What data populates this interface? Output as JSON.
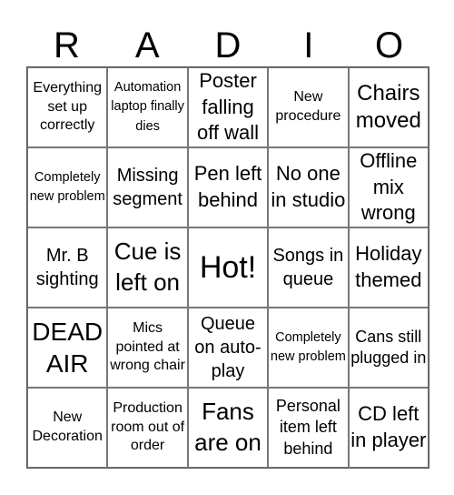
{
  "title_letters": [
    "R",
    "A",
    "D",
    "I",
    "O"
  ],
  "cells": [
    {
      "text": "Everything set up correctly"
    },
    {
      "text": "Automation laptop finally dies"
    },
    {
      "text": "Poster falling off wall"
    },
    {
      "text": "New procedure"
    },
    {
      "text": "Chairs moved"
    },
    {
      "text": "Completely new problem"
    },
    {
      "text": "Missing segment"
    },
    {
      "text": "Pen left behind"
    },
    {
      "text": "No one in studio"
    },
    {
      "text": "Offline mix wrong"
    },
    {
      "text": "Mr. B sighting"
    },
    {
      "text": "Cue is left on"
    },
    {
      "text": "Hot!"
    },
    {
      "text": "Songs in queue"
    },
    {
      "text": "Holiday themed"
    },
    {
      "text": "DEAD AIR"
    },
    {
      "text": "Mics pointed at wrong chair"
    },
    {
      "text": "Queue on auto-play"
    },
    {
      "text": "Completely new problem"
    },
    {
      "text": "Cans still plugged in"
    },
    {
      "text": "New Decoration"
    },
    {
      "text": "Production room out of order"
    },
    {
      "text": "Fans are on"
    },
    {
      "text": "Personal item left behind"
    },
    {
      "text": "CD left in player"
    }
  ]
}
